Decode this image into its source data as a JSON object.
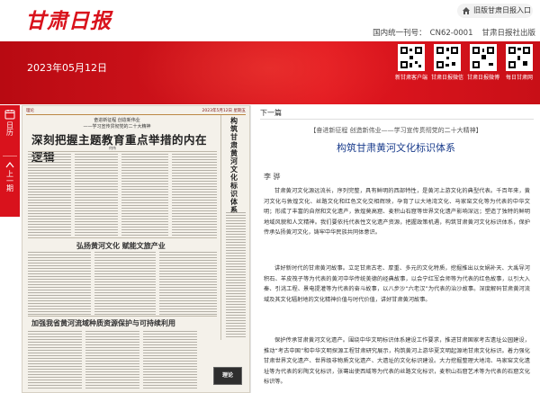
{
  "header": {
    "logo": "甘肃日报",
    "old_link": "旧版甘肃日报入口",
    "cn_label": "国内统一刊号：",
    "cn_code": "CN62-0001",
    "publisher": "甘肃日报社出版"
  },
  "banner": {
    "date": "2023年05月12日",
    "qr_codes": [
      {
        "label": "新甘肃客户端"
      },
      {
        "label": "甘肃日报微信"
      },
      {
        "label": "甘肃日报微博"
      },
      {
        "label": "每日甘肃网"
      }
    ]
  },
  "rail": {
    "calendar_label": "日历",
    "prev_label": "上一期"
  },
  "paper_page": {
    "edition": "理论",
    "edition_right": "2023年5月12日 星期五",
    "kicker1": "奋进新征程 创造新伟业",
    "kicker2": "——学习宣传贯彻党的二十大精神",
    "headline": "深刻把握主题教育重点举措的内在逻辑",
    "byline": "何伟",
    "vertical_title": "构筑甘肃黄河文化标识体系",
    "sub_headline": "弘扬黄河文化 赋能文旅产业",
    "bottom_headline": "加强我省黄河流域种质资源保护与可持续利用",
    "photo_label": "理论"
  },
  "article": {
    "next_link": "下一篇",
    "kicker": "【奋进新征程 创造新伟业——学习宣传贯彻党的二十大精神】",
    "title": "构筑甘肃黄河文化标识体系",
    "author": "李 骅",
    "paragraphs": [
      "甘肃黄河文化源远流长，序列完整，具有鲜明的西部特性，是黄河上游文化的典型代表。千百年来，黄河文化与敦煌文化、丝路文化和红色文化交相辉映，孕育了以大地湾文化、马家窑文化等为代表的中华文明；形成了丰富的自然和文化遗产，敦煌莫高窟、麦积山石窟等世界文化遗产影响深远；塑造了独特的鲜明地域风貌和人文精神。我们要依托代表性文化遗产资源，把握政策机遇，构筑甘肃黄河文化标识体系，保护传承弘扬黄河文化，铸牢中华民族共同体意识。",
      "讲好新时代的甘肃黄河故事。立足甘肃古老、厚重、多元的文化特质，挖掘推出以女娲补天、大禹导河积石、羊皮筏子等为代表的黄河中华传统美德的经典故事，以会宁红军会师等为代表的红色故事，以引大入秦、引洮工程、景电提灌等为代表的奋斗故事，以八步沙“六老汉”为代表的治沙故事。深度解码甘肃黄河流域及其文化辐射地的文化精神价值与时代价值，讲好甘肃黄河故事。",
      "保护传承甘肃黄河文化遗产。围绕中华文明标识体系建设工作要求，推进甘肃国家考古遗址公园建设，推动“考古中国”和中华文明探源工程甘肃研究展示，构筑黄河上游华夏文明起源地甘肃文化标识。着力强化甘肃世界文化遗产、世界级非物质文化遗产、大遗址的文化标识建设。大力挖掘整理大地湾、马家窑文化遗址等为代表的彩陶文化标识，张骞出使西域等为代表的丝路文化标识，麦积山石窟艺术等为代表的石窟文化标识等。"
    ]
  },
  "colors": {
    "brand_red": "#d9121c",
    "title_blue": "#1a3c8c"
  }
}
